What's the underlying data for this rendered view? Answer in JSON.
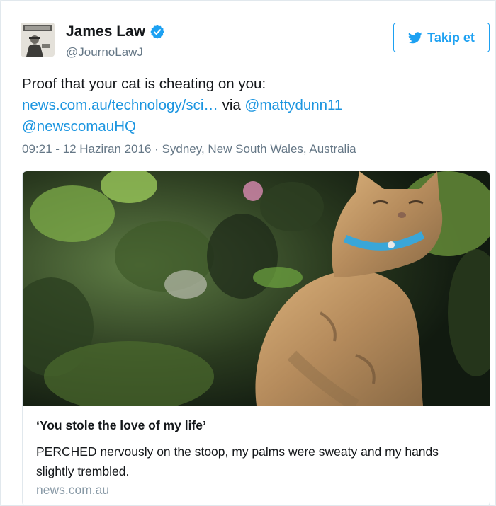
{
  "user": {
    "display_name": "James Law",
    "handle": "@JournoLawJ",
    "verified": true
  },
  "follow_button": {
    "label": "Takip et"
  },
  "tweet": {
    "text_intro": "Proof that your cat is cheating on you:",
    "link_url": "news.com.au/technology/sci…",
    "via_text": "via",
    "mention_1": "@mattydunn11",
    "mention_2": "@newscomauHQ",
    "timestamp": "09:21 - 12 Haziran 2016",
    "separator": "·",
    "location": "Sydney, New South Wales, Australia"
  },
  "card": {
    "title": "‘You stole the love of my life’",
    "description": "PERCHED nervously on the stoop, my palms were sweaty and my hands slightly trembled.",
    "domain": "news.com.au"
  },
  "colors": {
    "brand_blue": "#1da1f2",
    "link_blue": "#1b95e0",
    "text_primary": "#14171a",
    "text_secondary": "#657786",
    "collar": "#3aa6d8"
  },
  "icons": {
    "verified": "verified-badge-icon",
    "follow": "bird-icon"
  }
}
